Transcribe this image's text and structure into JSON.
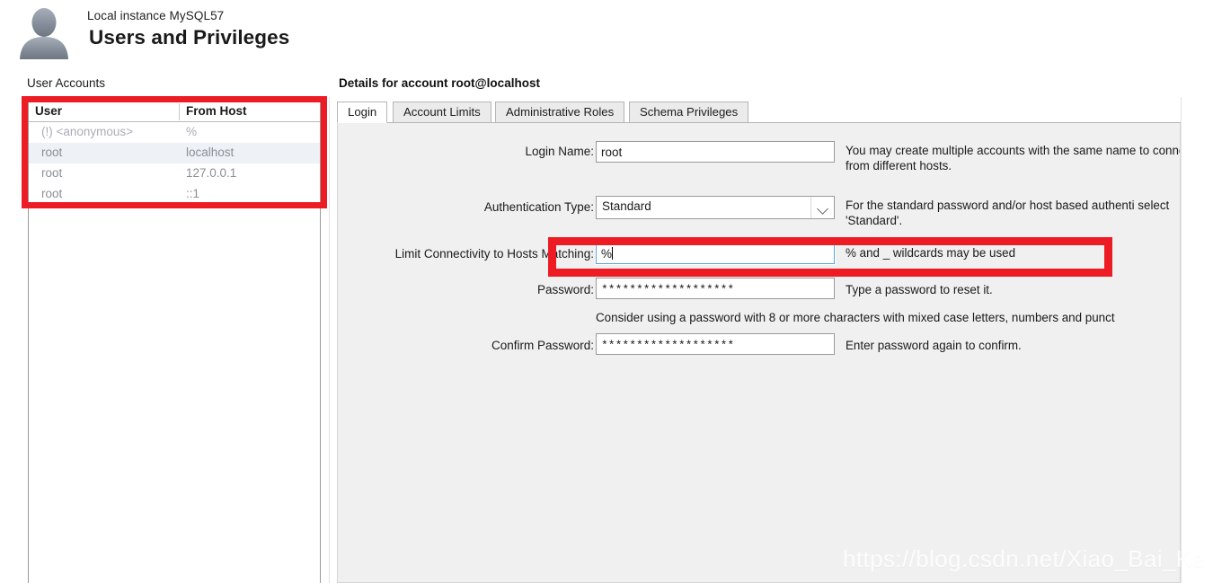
{
  "header": {
    "subtitle": "Local instance MySQL57",
    "title": "Users and Privileges",
    "avatar_icon": "user-silhouette-icon"
  },
  "left_pane": {
    "section_label": "User Accounts",
    "columns": [
      "User",
      "From Host"
    ],
    "rows": [
      {
        "user": "(!) <anonymous>",
        "host": "%",
        "selected": false,
        "warning": true
      },
      {
        "user": "root",
        "host": "localhost",
        "selected": true,
        "warning": false
      },
      {
        "user": "root",
        "host": "127.0.0.1",
        "selected": false,
        "warning": false
      },
      {
        "user": "root",
        "host": "::1",
        "selected": false,
        "warning": false
      }
    ]
  },
  "details": {
    "section_label": "Details for account root@localhost",
    "tabs": [
      {
        "label": "Login",
        "active": true
      },
      {
        "label": "Account Limits",
        "active": false
      },
      {
        "label": "Administrative Roles",
        "active": false
      },
      {
        "label": "Schema Privileges",
        "active": false
      }
    ],
    "fields": {
      "login_name": {
        "label": "Login Name:",
        "value": "root",
        "hint": "You may create multiple accounts with the same name to connect from different hosts."
      },
      "authentication_type": {
        "label": "Authentication Type:",
        "value": "Standard",
        "options": [
          "Standard"
        ],
        "hint": "For the standard password and/or host based authenti select 'Standard'.",
        "dropdown_icon": "chevron-down-icon"
      },
      "limit_connectivity": {
        "label": "Limit Connectivity to Hosts Matching:",
        "value": "%",
        "hint": "% and _ wildcards may be used",
        "focused": true
      },
      "password": {
        "label": "Password:",
        "value": "*******************",
        "hint": "Type a password to reset it.",
        "note": "Consider using a password with 8 or more characters with mixed case letters, numbers and punct"
      },
      "confirm_password": {
        "label": "Confirm Password:",
        "value": "*******************",
        "hint": "Enter password again to confirm."
      }
    }
  },
  "annotations": {
    "highlight_color": "#ed1c24",
    "focus_color": "#57a3e6"
  },
  "watermark": {
    "text": "https://blog.csdn.net/Xiao_Bai_Ke"
  }
}
